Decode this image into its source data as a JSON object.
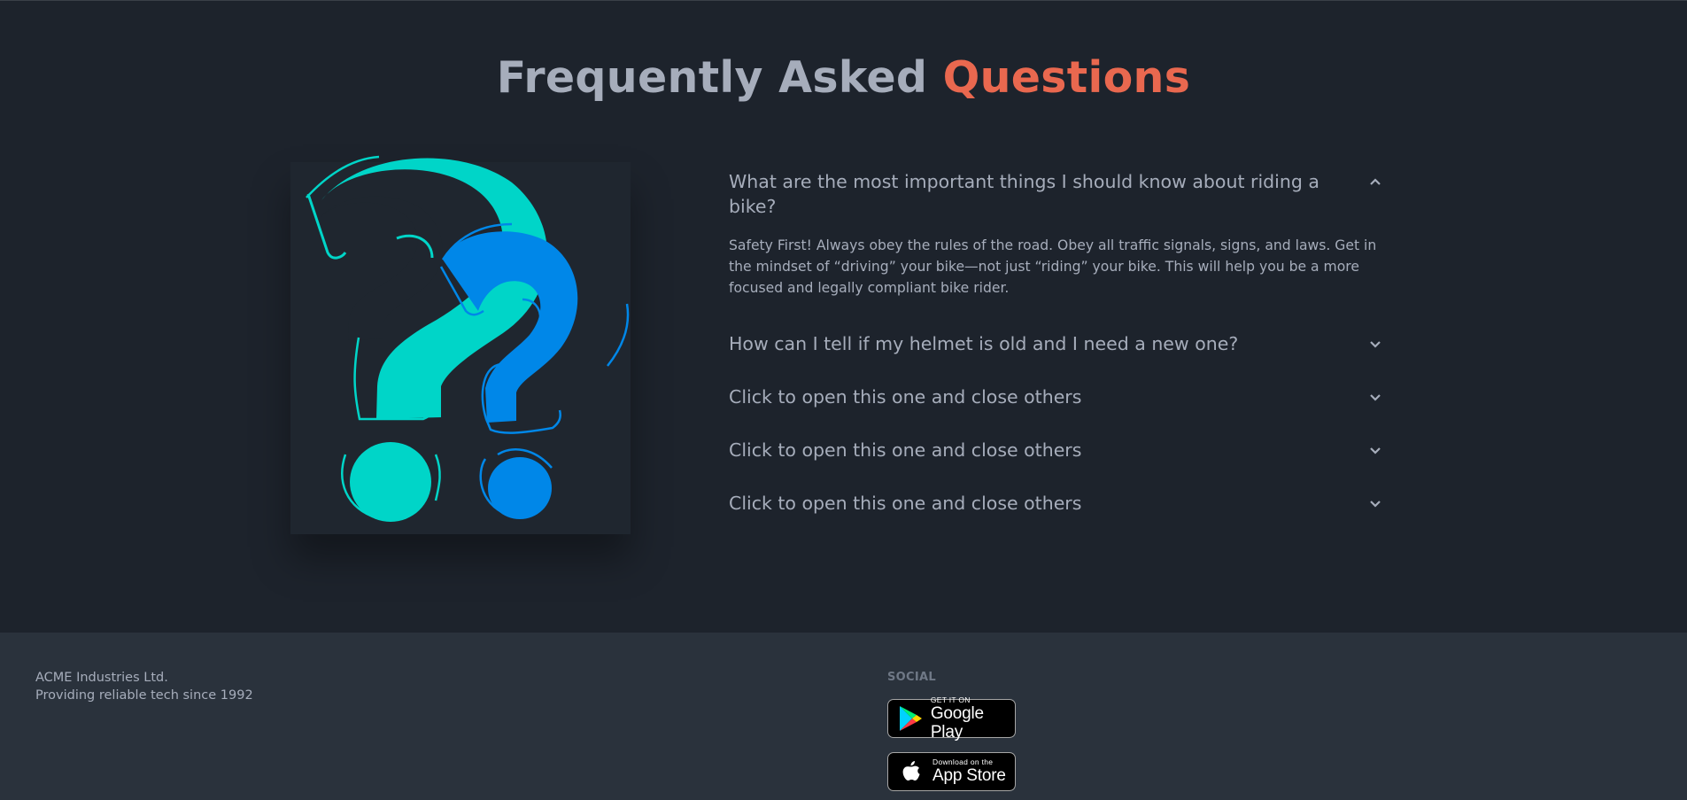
{
  "faq": {
    "title_main": "Frequently Asked",
    "title_accent": "Questions",
    "colors": {
      "accent": "#e9684f",
      "text": "#a6adbb",
      "teal": "#00d5c8",
      "blue": "#0087e8"
    },
    "items": [
      {
        "question": "What are the most important things I should know about riding a bike?",
        "answer": "Safety First! Always obey the rules of the road. Obey all traffic signals, signs, and laws. Get in the mindset of “driving” your bike—not just “riding” your bike. This will help you be a more focused and legally compliant bike rider.",
        "expanded": true,
        "icon": "chevron-up-icon"
      },
      {
        "question": "How can I tell if my helmet is old and I need a new one?",
        "expanded": false,
        "icon": "chevron-down-icon"
      },
      {
        "question": "Click to open this one and close others",
        "expanded": false,
        "icon": "chevron-down-icon"
      },
      {
        "question": "Click to open this one and close others",
        "expanded": false,
        "icon": "chevron-down-icon"
      },
      {
        "question": "Click to open this one and close others",
        "expanded": false,
        "icon": "chevron-down-icon"
      }
    ]
  },
  "footer": {
    "company_name": "ACME Industries Ltd.",
    "tagline": "Providing reliable tech since 1992",
    "social_title": "SOCIAL",
    "google_play": {
      "small": "GET IT ON",
      "big": "Google Play",
      "icon": "google-play-icon"
    },
    "app_store": {
      "small": "Download on the",
      "big": "App Store",
      "icon": "apple-icon"
    }
  }
}
